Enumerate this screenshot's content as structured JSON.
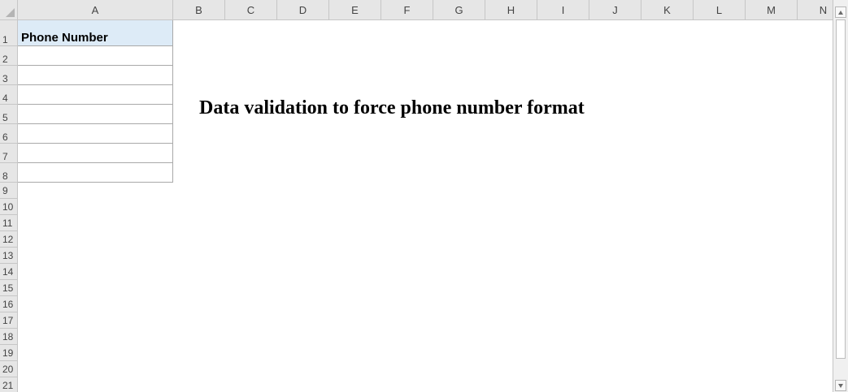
{
  "columns": [
    "A",
    "B",
    "C",
    "D",
    "E",
    "F",
    "G",
    "H",
    "I",
    "J",
    "K",
    "L",
    "M",
    "N"
  ],
  "rows": [
    "1",
    "2",
    "3",
    "4",
    "5",
    "6",
    "7",
    "8",
    "9",
    "10",
    "11",
    "12",
    "13",
    "14",
    "15",
    "16",
    "17",
    "18",
    "19",
    "20",
    "21"
  ],
  "cells": {
    "A1": "Phone Number"
  },
  "sheet_title": "Data validation to force phone number format",
  "colors": {
    "header_fill": "#ddebf7",
    "header_band": "#e6e6e6",
    "grid_border": "#a9a9a9"
  }
}
